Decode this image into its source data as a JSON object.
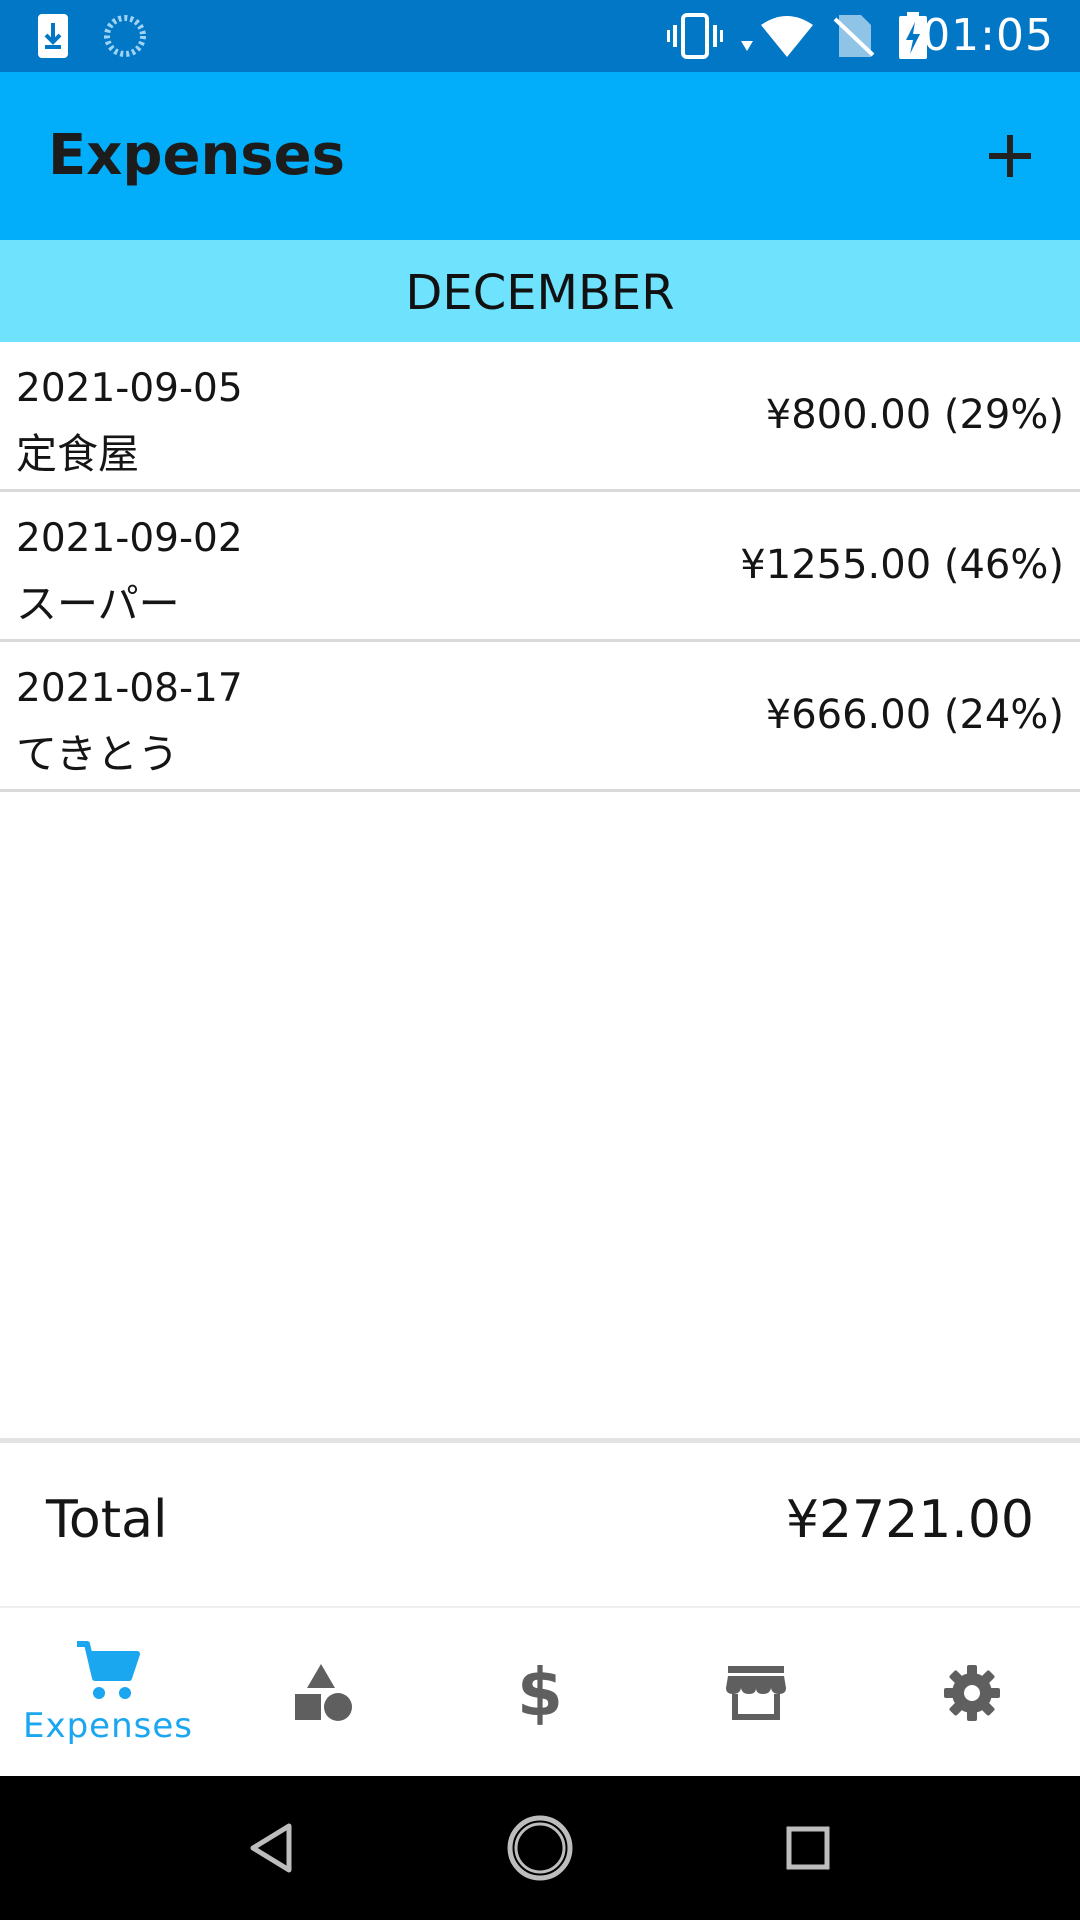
{
  "status_bar": {
    "time": "01:05",
    "icons": [
      "download-icon",
      "loading-icon",
      "vibrate-icon",
      "wifi-icon",
      "no-sim-icon",
      "battery-charging-icon"
    ]
  },
  "toolbar": {
    "title": "Expenses",
    "add_icon": "plus-icon"
  },
  "month_header": {
    "label": "DECEMBER"
  },
  "expenses": [
    {
      "date": "2021-09-05",
      "name": "定食屋",
      "amount": "¥800.00 (29%)"
    },
    {
      "date": "2021-09-02",
      "name": "スーパー",
      "amount": "¥1255.00 (46%)"
    },
    {
      "date": "2021-08-17",
      "name": "てきとう",
      "amount": "¥666.00 (24%)"
    }
  ],
  "total": {
    "label": "Total",
    "value": "¥2721.00"
  },
  "bottom_nav": {
    "items": [
      {
        "icon": "cart-icon",
        "label": "Expenses",
        "active": true
      },
      {
        "icon": "categories-icon",
        "label": "",
        "active": false
      },
      {
        "icon": "dollar-icon",
        "label": "",
        "active": false
      },
      {
        "icon": "store-icon",
        "label": "",
        "active": false
      },
      {
        "icon": "gear-icon",
        "label": "",
        "active": false
      }
    ]
  },
  "system_nav": {
    "items": [
      "back-icon",
      "home-icon",
      "recents-icon"
    ]
  },
  "colors": {
    "status_bar": "#0177c6",
    "toolbar": "#02aefa",
    "month_header": "#6fe2fe",
    "accent": "#1ba6f0",
    "icon_inactive": "#5f5f5f"
  }
}
